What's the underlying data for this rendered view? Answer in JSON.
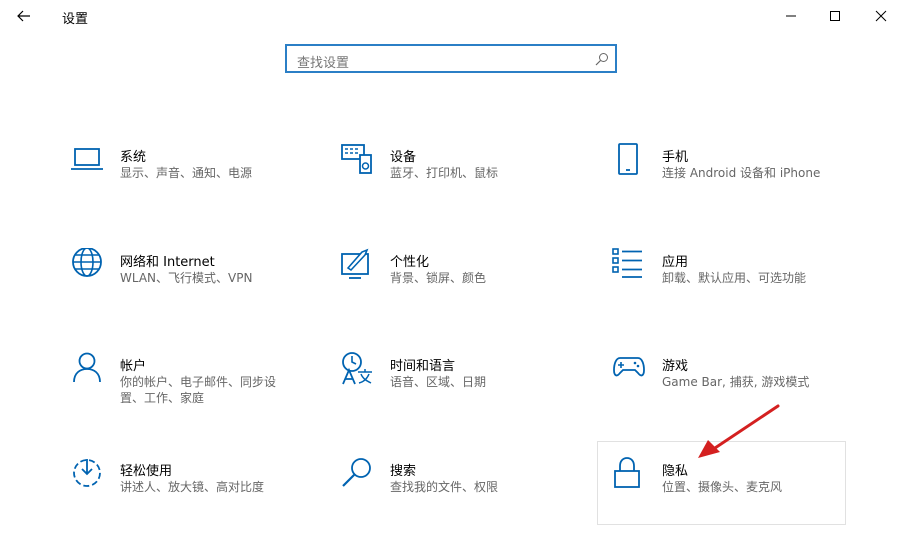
{
  "window": {
    "title": "设置"
  },
  "search": {
    "placeholder": "查找设置"
  },
  "tiles": [
    {
      "name": "系统",
      "desc": "显示、声音、通知、电源",
      "icon": "laptop-icon"
    },
    {
      "name": "设备",
      "desc": "蓝牙、打印机、鼠标",
      "icon": "devices-icon"
    },
    {
      "name": "手机",
      "desc": "连接 Android 设备和 iPhone",
      "icon": "phone-icon"
    },
    {
      "name": "网络和 Internet",
      "desc": "WLAN、飞行模式、VPN",
      "icon": "globe-icon"
    },
    {
      "name": "个性化",
      "desc": "背景、锁屏、颜色",
      "icon": "paint-icon"
    },
    {
      "name": "应用",
      "desc": "卸载、默认应用、可选功能",
      "icon": "apps-list-icon"
    },
    {
      "name": "帐户",
      "desc": "你的帐户、电子邮件、同步设置、工作、家庭",
      "icon": "person-icon"
    },
    {
      "name": "时间和语言",
      "desc": "语音、区域、日期",
      "icon": "time-language-icon"
    },
    {
      "name": "游戏",
      "desc": "Game Bar, 捕获, 游戏模式",
      "icon": "gamepad-icon"
    },
    {
      "name": "轻松使用",
      "desc": "讲述人、放大镜、高对比度",
      "icon": "ease-of-access-icon"
    },
    {
      "name": "搜索",
      "desc": "查找我的文件、权限",
      "icon": "search-magnifier-icon"
    },
    {
      "name": "隐私",
      "desc": "位置、摄像头、麦克风",
      "icon": "lock-icon"
    }
  ],
  "colors": {
    "accent": "#0063b1",
    "search_border": "#2b7fc6",
    "annotation_arrow": "#d42020"
  }
}
